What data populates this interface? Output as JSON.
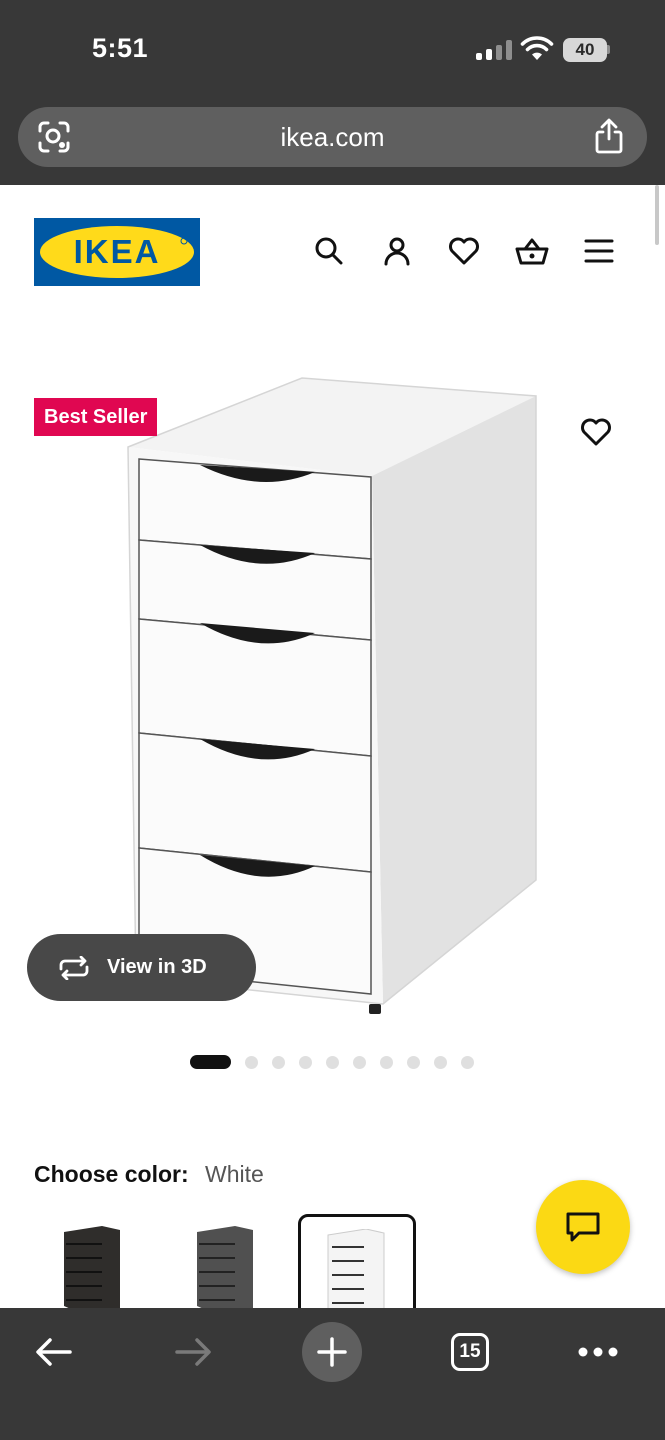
{
  "status_bar": {
    "time": "5:51",
    "battery": "40"
  },
  "browser": {
    "url": "ikea.com",
    "tab_count": "15"
  },
  "header": {
    "logo_text": "IKEA",
    "icons": [
      "search-icon",
      "account-icon",
      "heart-icon",
      "basket-icon",
      "menu-icon"
    ]
  },
  "product": {
    "badge": "Best Seller",
    "view_3d_label": "View in 3D",
    "image_count": 10,
    "active_image": 0,
    "color_label": "Choose color:",
    "color_value": "White",
    "swatches": [
      {
        "name": "black-brown",
        "color": "#2f2d2b",
        "selected": false
      },
      {
        "name": "gray-turquoise",
        "color": "#505050",
        "selected": false
      },
      {
        "name": "white",
        "color": "#f4f4f4",
        "selected": true
      }
    ]
  },
  "colors": {
    "ikea_blue": "#0058a3",
    "ikea_yellow": "#ffda1a",
    "badge": "#e00751",
    "chrome": "#383838",
    "chat_fab": "#fbd914"
  }
}
